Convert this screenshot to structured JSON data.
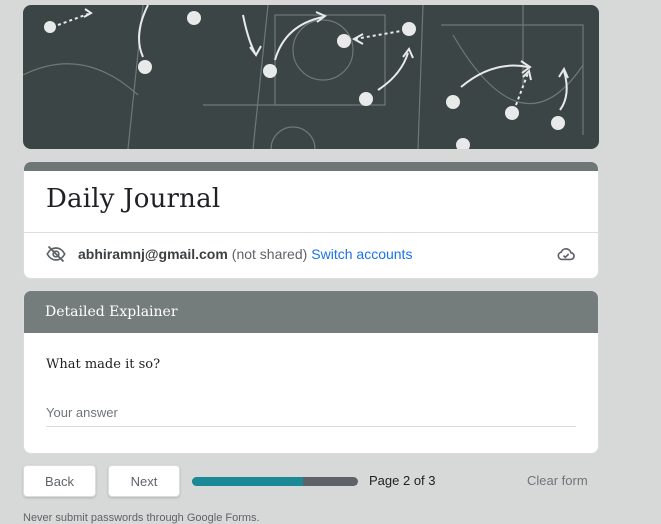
{
  "form": {
    "title": "Daily Journal",
    "account": {
      "email": "abhiramnj@gmail.com",
      "not_shared": "(not shared)",
      "switch_accounts": "Switch accounts"
    },
    "section": {
      "title": "Detailed Explainer",
      "question": "What made it so?",
      "answer_placeholder": "Your answer"
    },
    "nav": {
      "back": "Back",
      "next": "Next",
      "page_label": "Page 2 of 3",
      "clear": "Clear form",
      "progress_fraction": 0.667
    },
    "footer_text": "Never submit passwords through Google Forms."
  },
  "colors": {
    "accent": "#1a73e8",
    "theme": "#757c7c",
    "progress": "#1b8a97",
    "page_bg": "#d7d9d9"
  },
  "icons": {
    "visibility": "eye-off-icon",
    "cloud": "cloud-done-icon",
    "banner": "basketball-playbook-illustration"
  }
}
